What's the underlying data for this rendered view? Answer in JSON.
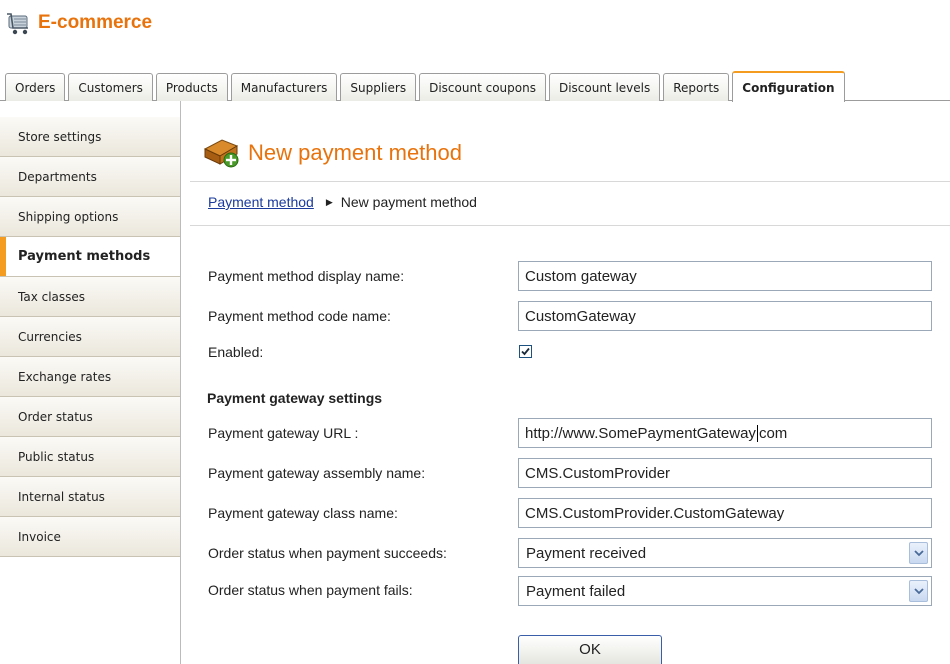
{
  "app": {
    "title": "E-commerce",
    "icon": "cart-icon"
  },
  "tabs": [
    {
      "label": "Orders"
    },
    {
      "label": "Customers"
    },
    {
      "label": "Products"
    },
    {
      "label": "Manufacturers"
    },
    {
      "label": "Suppliers"
    },
    {
      "label": "Discount coupons"
    },
    {
      "label": "Discount levels"
    },
    {
      "label": "Reports"
    },
    {
      "label": "Configuration",
      "active": true
    }
  ],
  "sidebar": {
    "items": [
      {
        "label": "Store settings"
      },
      {
        "label": "Departments"
      },
      {
        "label": "Shipping options"
      },
      {
        "label": "Payment methods",
        "active": true
      },
      {
        "label": "Tax classes"
      },
      {
        "label": "Currencies"
      },
      {
        "label": "Exchange rates"
      },
      {
        "label": "Order status"
      },
      {
        "label": "Public status"
      },
      {
        "label": "Internal status"
      },
      {
        "label": "Invoice"
      }
    ]
  },
  "page": {
    "title": "New payment method",
    "icon": "payment-method-add-icon",
    "breadcrumb": {
      "link": "Payment method",
      "current": "New payment method"
    }
  },
  "form": {
    "display_name": {
      "label": "Payment method display name:",
      "value": "Custom gateway"
    },
    "code_name": {
      "label": "Payment method code name:",
      "value": "CustomGateway"
    },
    "enabled": {
      "label": "Enabled:",
      "checked": true
    },
    "section_title": "Payment gateway settings",
    "gateway_url": {
      "label": "Payment gateway URL :",
      "value_before_caret": "http://www.SomePaymentGateway",
      "value_after_caret": "com"
    },
    "assembly_name": {
      "label": "Payment gateway assembly name:",
      "value": "CMS.CustomProvider"
    },
    "class_name": {
      "label": "Payment gateway class name:",
      "value": "CMS.CustomProvider.CustomGateway"
    },
    "status_success": {
      "label": "Order status when payment succeeds:",
      "selected": "Payment received"
    },
    "status_fail": {
      "label": "Order status when payment fails:",
      "selected": "Payment failed"
    },
    "ok_label": "OK"
  },
  "colors": {
    "accent": "#e8730c",
    "tab_highlight": "#f39c1f",
    "link": "#1a3a9c"
  }
}
